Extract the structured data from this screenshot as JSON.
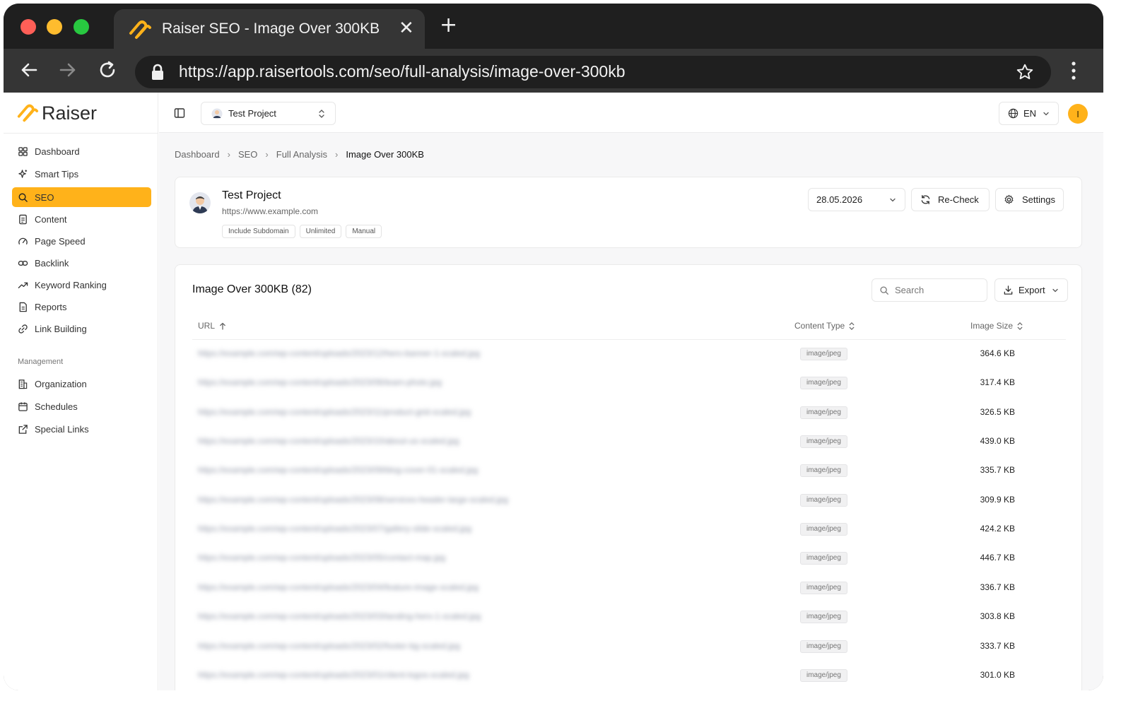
{
  "browser": {
    "tab_title": "Raiser SEO - Image Over 300KB",
    "url": "https://app.raisertools.com/seo/full-analysis/image-over-300kb"
  },
  "app": {
    "brand": "Raiser",
    "accent": "#ffb21a"
  },
  "sidebar": {
    "items": [
      {
        "label": "Dashboard",
        "icon": "grid-icon"
      },
      {
        "label": "Smart Tips",
        "icon": "sparkles-icon"
      },
      {
        "label": "SEO",
        "icon": "search-icon",
        "active": true
      },
      {
        "label": "Content",
        "icon": "file-icon"
      },
      {
        "label": "Page Speed",
        "icon": "gauge-icon"
      },
      {
        "label": "Backlink",
        "icon": "link-icon"
      },
      {
        "label": "Keyword Ranking",
        "icon": "trending-icon"
      },
      {
        "label": "Reports",
        "icon": "report-icon"
      },
      {
        "label": "Link Building",
        "icon": "chain-icon"
      }
    ],
    "management_label": "Management",
    "management_items": [
      {
        "label": "Organization",
        "icon": "building-icon"
      },
      {
        "label": "Schedules",
        "icon": "calendar-icon"
      },
      {
        "label": "Special Links",
        "icon": "external-link-icon"
      }
    ]
  },
  "header": {
    "project": "Test Project",
    "language": "EN",
    "user_initial": "I"
  },
  "breadcrumbs": [
    "Dashboard",
    "SEO",
    "Full Analysis",
    "Image Over 300KB"
  ],
  "project_card": {
    "name": "Test Project",
    "url": "https://www.example.com",
    "tags": [
      "Include Subdomain",
      "Unlimited",
      "Manual"
    ],
    "date": "28.05.2026",
    "recheck_label": "Re-Check",
    "settings_label": "Settings"
  },
  "table": {
    "title": "Image Over 300KB (82)",
    "search_placeholder": "Search",
    "export_label": "Export",
    "columns": [
      "URL",
      "Content Type",
      "Image Size"
    ],
    "rows": [
      {
        "url": "https://example.com/wp-content/uploads/2023/12/hero-banner-1-scaled.jpg",
        "type": "image/jpeg",
        "size": "364.6 KB"
      },
      {
        "url": "https://example.com/wp-content/uploads/2023/06/team-photo.jpg",
        "type": "image/jpeg",
        "size": "317.4 KB"
      },
      {
        "url": "https://example.com/wp-content/uploads/2023/11/product-grid-scaled.jpg",
        "type": "image/jpeg",
        "size": "326.5 KB"
      },
      {
        "url": "https://example.com/wp-content/uploads/2023/10/about-us-scaled.jpg",
        "type": "image/jpeg",
        "size": "439.0 KB"
      },
      {
        "url": "https://example.com/wp-content/uploads/2023/09/blog-cover-01-scaled.jpg",
        "type": "image/jpeg",
        "size": "335.7 KB"
      },
      {
        "url": "https://example.com/wp-content/uploads/2023/08/services-header-large-scaled.jpg",
        "type": "image/jpeg",
        "size": "309.9 KB"
      },
      {
        "url": "https://example.com/wp-content/uploads/2023/07/gallery-slide-scaled.jpg",
        "type": "image/jpeg",
        "size": "424.2 KB"
      },
      {
        "url": "https://example.com/wp-content/uploads/2023/05/contact-map.jpg",
        "type": "image/jpeg",
        "size": "446.7 KB"
      },
      {
        "url": "https://example.com/wp-content/uploads/2023/04/feature-image-scaled.jpg",
        "type": "image/jpeg",
        "size": "336.7 KB"
      },
      {
        "url": "https://example.com/wp-content/uploads/2023/03/landing-hero-1-scaled.jpg",
        "type": "image/jpeg",
        "size": "303.8 KB"
      },
      {
        "url": "https://example.com/wp-content/uploads/2023/02/footer-bg-scaled.jpg",
        "type": "image/jpeg",
        "size": "333.7 KB"
      },
      {
        "url": "https://example.com/wp-content/uploads/2023/01/client-logos-scaled.jpg",
        "type": "image/jpeg",
        "size": "301.0 KB"
      }
    ]
  }
}
